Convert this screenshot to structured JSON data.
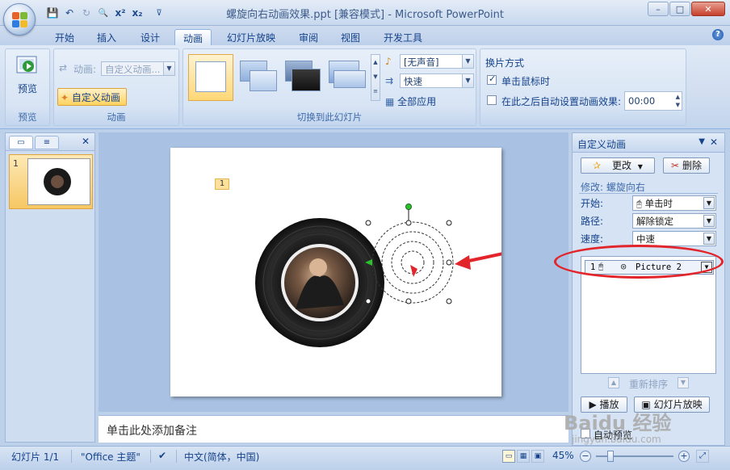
{
  "window": {
    "title": "螺旋向右动画效果.ppt [兼容模式] - Microsoft PowerPoint",
    "min_glyph": "–",
    "max_glyph": "□",
    "close_glyph": "✕"
  },
  "qat": {
    "save_icon": "💾",
    "undo_icon": "↶",
    "redo_icon": "↻",
    "preview_icon": "🔍",
    "superscript": "x²",
    "subscript": "x₂",
    "customize_icon": "⊽"
  },
  "tabs": [
    {
      "label": "开始"
    },
    {
      "label": "插入"
    },
    {
      "label": "设计"
    },
    {
      "label": "动画"
    },
    {
      "label": "幻灯片放映"
    },
    {
      "label": "审阅"
    },
    {
      "label": "视图"
    },
    {
      "label": "开发工具"
    }
  ],
  "ribbon": {
    "preview": {
      "button_label": "预览",
      "group_label": "预览"
    },
    "animation": {
      "animate_label": "动画:",
      "animate_value": "自定义动画...",
      "custom_button": "自定义动画",
      "group_label": "动画"
    },
    "transition": {
      "sound_value": "[无声音]",
      "speed_value": "快速",
      "apply_all": "全部应用",
      "group_label": "切换到此幻灯片"
    },
    "advance": {
      "header": "换片方式",
      "on_click": "单击鼠标时",
      "on_click_checked": true,
      "after_label": "在此之后自动设置动画效果:",
      "after_checked": false,
      "after_value": "00:00"
    }
  },
  "left_panel": {
    "slide_number": "1",
    "close_glyph": "✕"
  },
  "slide": {
    "animation_tag": "1"
  },
  "notes": {
    "placeholder": "单击此处添加备注"
  },
  "custom_anim_pane": {
    "title": "自定义动画",
    "change_button": "更改",
    "remove_button": "删除",
    "modify_text": "修改: 螺旋向右",
    "start_label": "开始:",
    "start_value": "单击时",
    "path_label": "路径:",
    "path_value": "解除锁定",
    "speed_label": "速度:",
    "speed_value": "中速",
    "list_item": {
      "index": "1",
      "name": "Picture 2"
    },
    "reorder_label": "重新排序",
    "play_button": "播放",
    "slideshow_button": "幻灯片放映",
    "autopreview_label": "自动预览",
    "autopreview_checked": false
  },
  "status_bar": {
    "slide_info": "幻灯片 1/1",
    "theme": "\"Office 主题\"",
    "language": "中文(简体，中国)",
    "zoom": "45%"
  },
  "watermark": {
    "brand": "Baidu 经验",
    "url": "jingyan.baidu.com"
  },
  "colors": {
    "accent_red": "#e2242b",
    "ribbon_blue": "#15428b",
    "selected_orange": "#f6c764"
  }
}
